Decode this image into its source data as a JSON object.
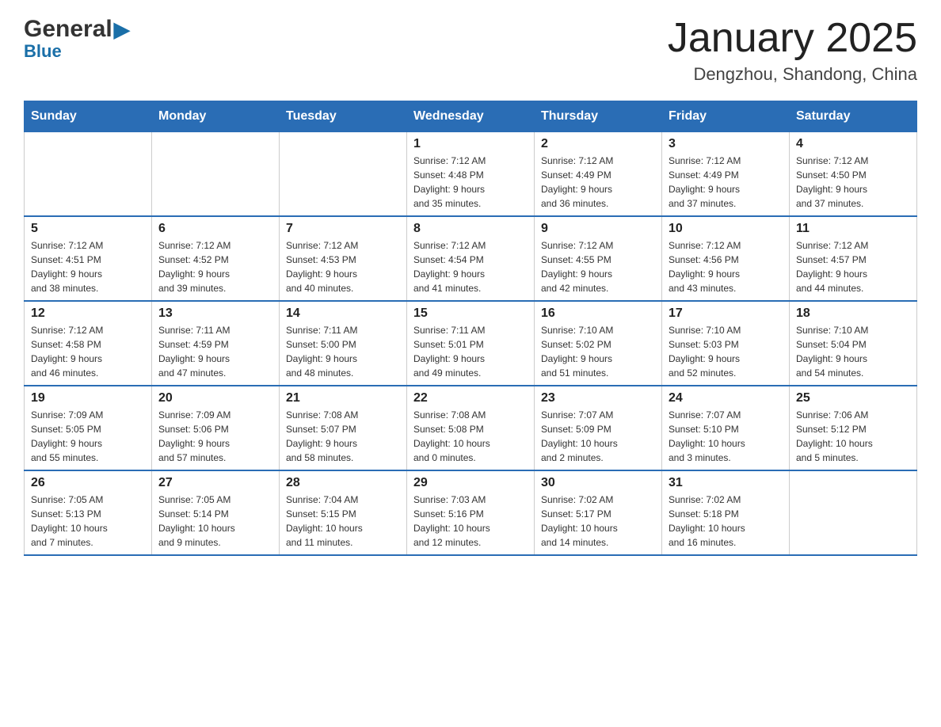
{
  "header": {
    "logo_general": "General",
    "logo_blue": "Blue",
    "month_title": "January 2025",
    "location": "Dengzhou, Shandong, China"
  },
  "days_of_week": [
    "Sunday",
    "Monday",
    "Tuesday",
    "Wednesday",
    "Thursday",
    "Friday",
    "Saturday"
  ],
  "weeks": [
    [
      {
        "day": "",
        "info": ""
      },
      {
        "day": "",
        "info": ""
      },
      {
        "day": "",
        "info": ""
      },
      {
        "day": "1",
        "info": "Sunrise: 7:12 AM\nSunset: 4:48 PM\nDaylight: 9 hours\nand 35 minutes."
      },
      {
        "day": "2",
        "info": "Sunrise: 7:12 AM\nSunset: 4:49 PM\nDaylight: 9 hours\nand 36 minutes."
      },
      {
        "day": "3",
        "info": "Sunrise: 7:12 AM\nSunset: 4:49 PM\nDaylight: 9 hours\nand 37 minutes."
      },
      {
        "day": "4",
        "info": "Sunrise: 7:12 AM\nSunset: 4:50 PM\nDaylight: 9 hours\nand 37 minutes."
      }
    ],
    [
      {
        "day": "5",
        "info": "Sunrise: 7:12 AM\nSunset: 4:51 PM\nDaylight: 9 hours\nand 38 minutes."
      },
      {
        "day": "6",
        "info": "Sunrise: 7:12 AM\nSunset: 4:52 PM\nDaylight: 9 hours\nand 39 minutes."
      },
      {
        "day": "7",
        "info": "Sunrise: 7:12 AM\nSunset: 4:53 PM\nDaylight: 9 hours\nand 40 minutes."
      },
      {
        "day": "8",
        "info": "Sunrise: 7:12 AM\nSunset: 4:54 PM\nDaylight: 9 hours\nand 41 minutes."
      },
      {
        "day": "9",
        "info": "Sunrise: 7:12 AM\nSunset: 4:55 PM\nDaylight: 9 hours\nand 42 minutes."
      },
      {
        "day": "10",
        "info": "Sunrise: 7:12 AM\nSunset: 4:56 PM\nDaylight: 9 hours\nand 43 minutes."
      },
      {
        "day": "11",
        "info": "Sunrise: 7:12 AM\nSunset: 4:57 PM\nDaylight: 9 hours\nand 44 minutes."
      }
    ],
    [
      {
        "day": "12",
        "info": "Sunrise: 7:12 AM\nSunset: 4:58 PM\nDaylight: 9 hours\nand 46 minutes."
      },
      {
        "day": "13",
        "info": "Sunrise: 7:11 AM\nSunset: 4:59 PM\nDaylight: 9 hours\nand 47 minutes."
      },
      {
        "day": "14",
        "info": "Sunrise: 7:11 AM\nSunset: 5:00 PM\nDaylight: 9 hours\nand 48 minutes."
      },
      {
        "day": "15",
        "info": "Sunrise: 7:11 AM\nSunset: 5:01 PM\nDaylight: 9 hours\nand 49 minutes."
      },
      {
        "day": "16",
        "info": "Sunrise: 7:10 AM\nSunset: 5:02 PM\nDaylight: 9 hours\nand 51 minutes."
      },
      {
        "day": "17",
        "info": "Sunrise: 7:10 AM\nSunset: 5:03 PM\nDaylight: 9 hours\nand 52 minutes."
      },
      {
        "day": "18",
        "info": "Sunrise: 7:10 AM\nSunset: 5:04 PM\nDaylight: 9 hours\nand 54 minutes."
      }
    ],
    [
      {
        "day": "19",
        "info": "Sunrise: 7:09 AM\nSunset: 5:05 PM\nDaylight: 9 hours\nand 55 minutes."
      },
      {
        "day": "20",
        "info": "Sunrise: 7:09 AM\nSunset: 5:06 PM\nDaylight: 9 hours\nand 57 minutes."
      },
      {
        "day": "21",
        "info": "Sunrise: 7:08 AM\nSunset: 5:07 PM\nDaylight: 9 hours\nand 58 minutes."
      },
      {
        "day": "22",
        "info": "Sunrise: 7:08 AM\nSunset: 5:08 PM\nDaylight: 10 hours\nand 0 minutes."
      },
      {
        "day": "23",
        "info": "Sunrise: 7:07 AM\nSunset: 5:09 PM\nDaylight: 10 hours\nand 2 minutes."
      },
      {
        "day": "24",
        "info": "Sunrise: 7:07 AM\nSunset: 5:10 PM\nDaylight: 10 hours\nand 3 minutes."
      },
      {
        "day": "25",
        "info": "Sunrise: 7:06 AM\nSunset: 5:12 PM\nDaylight: 10 hours\nand 5 minutes."
      }
    ],
    [
      {
        "day": "26",
        "info": "Sunrise: 7:05 AM\nSunset: 5:13 PM\nDaylight: 10 hours\nand 7 minutes."
      },
      {
        "day": "27",
        "info": "Sunrise: 7:05 AM\nSunset: 5:14 PM\nDaylight: 10 hours\nand 9 minutes."
      },
      {
        "day": "28",
        "info": "Sunrise: 7:04 AM\nSunset: 5:15 PM\nDaylight: 10 hours\nand 11 minutes."
      },
      {
        "day": "29",
        "info": "Sunrise: 7:03 AM\nSunset: 5:16 PM\nDaylight: 10 hours\nand 12 minutes."
      },
      {
        "day": "30",
        "info": "Sunrise: 7:02 AM\nSunset: 5:17 PM\nDaylight: 10 hours\nand 14 minutes."
      },
      {
        "day": "31",
        "info": "Sunrise: 7:02 AM\nSunset: 5:18 PM\nDaylight: 10 hours\nand 16 minutes."
      },
      {
        "day": "",
        "info": ""
      }
    ]
  ],
  "colors": {
    "header_bg": "#2a6db5",
    "header_text": "#ffffff",
    "border": "#cccccc",
    "logo_blue": "#1a6fa8"
  }
}
